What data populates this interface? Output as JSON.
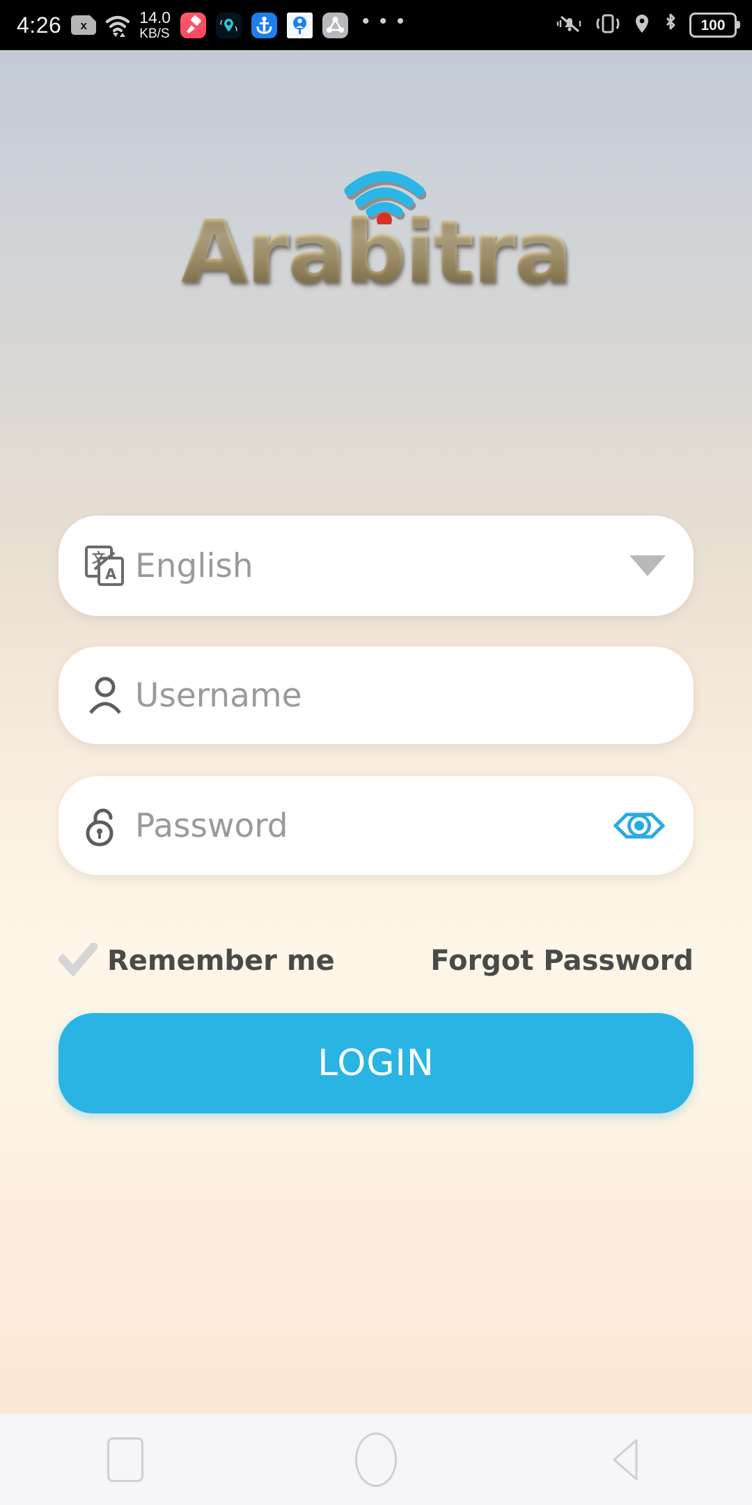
{
  "status_bar": {
    "time": "4:26",
    "sim_label": "x",
    "network_speed_value": "14.0",
    "network_speed_unit": "KB/S",
    "overflow_dots": "• • •",
    "battery_level": "100",
    "left_icons": [
      "sim-card-no-signal-icon",
      "wifi-icon",
      "app-brush-icon",
      "app-location-icon",
      "app-anchor-icon",
      "app-avatar-icon",
      "app-share-icon"
    ],
    "right_icons": [
      "bell-mute-icon",
      "vibrate-icon",
      "location-pin-icon",
      "bluetooth-icon",
      "battery-icon"
    ]
  },
  "logo": {
    "wordmark": "Arabitra",
    "wifi_arc_color": "#29b4e4",
    "wifi_dot_color": "#d63124",
    "gold_light": "#e3d3a6",
    "gold_dark": "#8e7a48"
  },
  "form": {
    "language": {
      "value": "English",
      "icon": "translate-icon",
      "dropdown_icon": "chevron-down-icon"
    },
    "username": {
      "placeholder": "Username",
      "value": "",
      "icon": "person-icon"
    },
    "password": {
      "placeholder": "Password",
      "value": "",
      "icon": "unlock-icon",
      "toggle_icon": "eye-icon",
      "toggle_color": "#29abe2"
    },
    "remember_me": {
      "label": "Remember me",
      "checked": true,
      "check_color": "#d5d5d5"
    },
    "forgot_password": {
      "label": "Forgot Password"
    },
    "login_button": {
      "label": "LOGIN",
      "color": "#29b4e4",
      "text_color": "#ffffff"
    }
  },
  "nav_bar": {
    "recents_label": "recents",
    "home_label": "home",
    "back_label": "back",
    "icon_color": "#cfcfd2"
  },
  "background": {
    "top_color": "#c2cad5",
    "bottom_color": "#fbe8d6"
  }
}
